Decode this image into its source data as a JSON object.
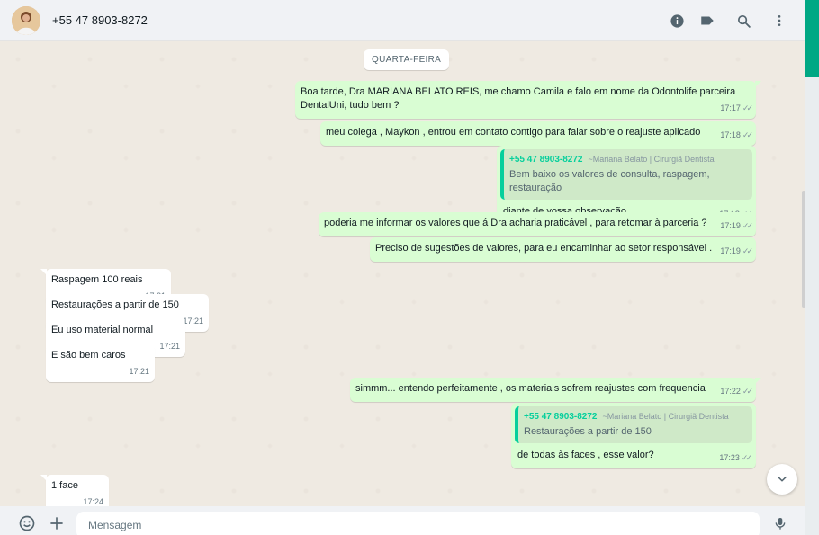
{
  "header": {
    "contact_name": "+55 47 8903-8272",
    "icons": [
      "info-icon",
      "label-icon",
      "search-icon",
      "menu-icon"
    ]
  },
  "chat": {
    "date_chip": "QUARTA-FEIRA",
    "messages": [
      {
        "dir": "out",
        "text_line1": "Boa tarde, Dra  MARIANA BELATO REIS, me chamo Camila e falo em nome da Odontolife parceira",
        "text_line2": "DentalUni, tudo bem ?",
        "time": "17:17"
      },
      {
        "dir": "out",
        "text": "meu colega , Maykon , entrou em contato contigo para falar sobre o reajuste aplicado",
        "time": "17:18"
      },
      {
        "dir": "out",
        "quote_author": "+55 47 8903-8272",
        "quote_sub": "~Mariana Belato | Cirurgiã Dentista",
        "quote_text": "Bem baixo os valores de consulta, raspagem, restauração",
        "text": "diante de vossa observação",
        "time": "17:18"
      },
      {
        "dir": "out",
        "text": "poderia me informar os valores que á Dra acharia praticável , para retomar à parceria ?",
        "time": "17:19"
      },
      {
        "dir": "out",
        "text": "Preciso de sugestões de valores, para eu encaminhar ao setor responsável .",
        "time": "17:19"
      },
      {
        "dir": "in",
        "text": "Raspagem 100 reais",
        "time": "17:21"
      },
      {
        "dir": "in",
        "text": "Restaurações a partir de 150",
        "time": "17:21"
      },
      {
        "dir": "in",
        "text": "Eu uso material normal",
        "time": "17:21"
      },
      {
        "dir": "in",
        "text": "E são bem caros",
        "time": "17:21"
      },
      {
        "dir": "out",
        "text": "simmm... entendo perfeitamente , os materiais sofrem reajustes com frequencia",
        "time": "17:22"
      },
      {
        "dir": "out",
        "quote_author": "+55 47 8903-8272",
        "quote_sub": "~Mariana Belato | Cirurgiã Dentista",
        "quote_text": "Restaurações a partir de 150",
        "text": "de todas às faces , esse valor?",
        "time": "17:23"
      },
      {
        "dir": "in",
        "text": "1 face",
        "time": "17:24"
      }
    ]
  },
  "footer": {
    "input_placeholder": "Mensagem",
    "icons": [
      "emoji-icon",
      "attach-plus-icon",
      "microphone-icon"
    ]
  },
  "colors": {
    "accent": "#00a884",
    "outgoing_bubble": "#d9fdd3",
    "incoming_bubble": "#ffffff",
    "chat_background": "#efeae2",
    "quote_author": "#06cf9c"
  }
}
